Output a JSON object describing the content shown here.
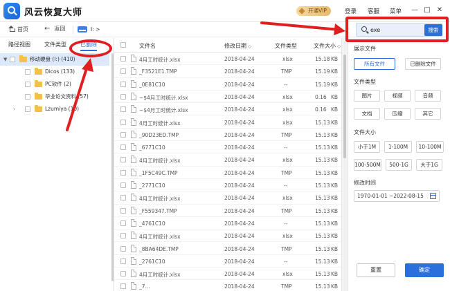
{
  "app": {
    "title": "风云恢复大师",
    "vip_label": "开通VIP",
    "menu": [
      "登录",
      "客服",
      "菜单"
    ],
    "window_controls": [
      "—",
      "□",
      "✕"
    ]
  },
  "nav": {
    "home": "首页",
    "back": "返回",
    "path": "I: >"
  },
  "left_tabs": [
    "路径视图",
    "文件类型",
    "已删除"
  ],
  "tree": [
    {
      "label": "移动硬盘 (I:) (410)",
      "level": 0,
      "expand": "▼",
      "selected": true
    },
    {
      "label": "Dicos (133)",
      "level": 1,
      "expand": "",
      "selected": false
    },
    {
      "label": "PC软件 (2)",
      "level": 1,
      "expand": "",
      "selected": false
    },
    {
      "label": "毕业论文资料 (57)",
      "level": 1,
      "expand": "",
      "selected": false
    },
    {
      "label": "Lzumiya (10)",
      "level": 1,
      "expand": "›",
      "selected": false
    }
  ],
  "table": {
    "columns": [
      "文件名",
      "修改日期",
      "文件类型",
      "文件大小"
    ],
    "rows": [
      {
        "name": "4月工时统计.xlsx",
        "date": "2018-04-24",
        "type": "xlsx",
        "size": "15.18",
        "unit": "KB"
      },
      {
        "name": "_F3521E1.TMP",
        "date": "2018-04-24",
        "type": "TMP",
        "size": "15.19",
        "unit": "KB"
      },
      {
        "name": "_0E81C10",
        "date": "2018-04-24",
        "type": "--",
        "size": "15.19",
        "unit": "KB"
      },
      {
        "name": "~$4月工时统计.xlsx",
        "date": "2018-04-24",
        "type": "xlsx",
        "size": "0.16",
        "unit": "KB"
      },
      {
        "name": "~$4月工时统计.xlsx",
        "date": "2018-04-24",
        "type": "xlsx",
        "size": "0.16",
        "unit": "KB"
      },
      {
        "name": "4月工时统计.xlsx",
        "date": "2018-04-24",
        "type": "xlsx",
        "size": "15.13",
        "unit": "KB"
      },
      {
        "name": "_90D23ED.TMP",
        "date": "2018-04-24",
        "type": "TMP",
        "size": "15.13",
        "unit": "KB"
      },
      {
        "name": "_6771C10",
        "date": "2018-04-24",
        "type": "--",
        "size": "15.13",
        "unit": "KB"
      },
      {
        "name": "4月工时统计.xlsx",
        "date": "2018-04-24",
        "type": "xlsx",
        "size": "15.13",
        "unit": "KB"
      },
      {
        "name": "_1F5C49C.TMP",
        "date": "2018-04-24",
        "type": "TMP",
        "size": "15.13",
        "unit": "KB"
      },
      {
        "name": "_2771C10",
        "date": "2018-04-24",
        "type": "--",
        "size": "15.13",
        "unit": "KB"
      },
      {
        "name": "4月工时统计.xlsx",
        "date": "2018-04-24",
        "type": "xlsx",
        "size": "15.13",
        "unit": "KB"
      },
      {
        "name": "_F559347.TMP",
        "date": "2018-04-24",
        "type": "TMP",
        "size": "15.13",
        "unit": "KB"
      },
      {
        "name": "_4761C10",
        "date": "2018-04-24",
        "type": "--",
        "size": "15.13",
        "unit": "KB"
      },
      {
        "name": "4月工时统计.xlsx",
        "date": "2018-04-24",
        "type": "xlsx",
        "size": "15.13",
        "unit": "KB"
      },
      {
        "name": "_8BA64DE.TMP",
        "date": "2018-04-24",
        "type": "TMP",
        "size": "15.13",
        "unit": "KB"
      },
      {
        "name": "_2761C10",
        "date": "2018-04-24",
        "type": "--",
        "size": "15.13",
        "unit": "KB"
      },
      {
        "name": "4月工时统计.xlsx",
        "date": "2018-04-24",
        "type": "xlsx",
        "size": "15.13",
        "unit": "KB"
      },
      {
        "name": "_7...",
        "date": "2018-04-24",
        "type": "TMP",
        "size": "15.13",
        "unit": "KB"
      }
    ]
  },
  "filter": {
    "search_value": "exe",
    "search_button": "搜索",
    "show_files_label": "展示文件",
    "show_options": [
      "所有文件",
      "已删除文件"
    ],
    "file_type_label": "文件类型",
    "file_types": [
      "图片",
      "视频",
      "音频",
      "文档",
      "压缩",
      "其它"
    ],
    "file_size_label": "文件大小",
    "file_sizes": [
      "小于1M",
      "1-100M",
      "10-100M",
      "100-500M",
      "500-1G",
      "大于1G"
    ],
    "modified_label": "修改时间",
    "date_range": "1970-01-01 ~2022-08-15",
    "reset": "重置",
    "confirm": "确定"
  },
  "colors": {
    "accent": "#2a6fdb",
    "annotation": "#e02020",
    "folder": "#f1c14b",
    "vip": "#e7b96a"
  }
}
